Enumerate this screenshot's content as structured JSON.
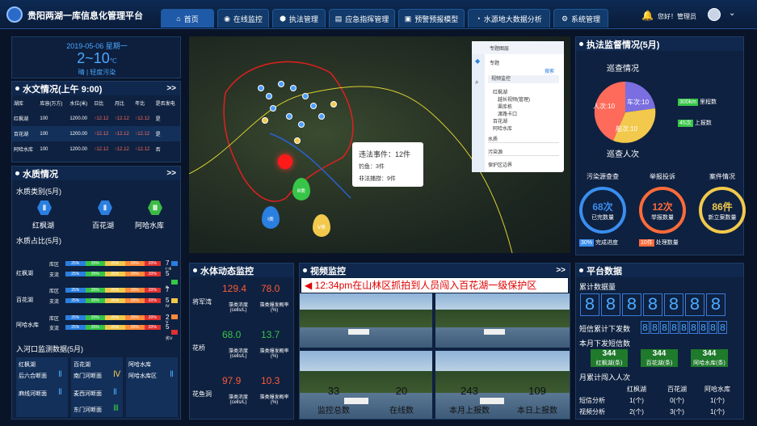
{
  "app": {
    "title": "贵阳两湖一库信息化管理平台"
  },
  "nav": [
    {
      "label": "首页",
      "icon": "⌂"
    },
    {
      "label": "在线监控",
      "icon": "◉"
    },
    {
      "label": "执法管理",
      "icon": "⬢"
    },
    {
      "label": "应急指挥管理",
      "icon": "▤"
    },
    {
      "label": "预警预报模型",
      "icon": "▣"
    },
    {
      "label": "水源地大数据分析",
      "icon": "◔"
    },
    {
      "label": "系统管理",
      "icon": "⚙"
    }
  ],
  "user": {
    "greeting": "您好！管理员"
  },
  "weather": {
    "date": "2019-05-06 星期一",
    "temp": "2~10",
    "unit": "℃",
    "desc": "晴 | 轻度污染"
  },
  "hydro": {
    "title": "水文情况(上午 9:00)",
    "more": ">>",
    "headers": [
      "湖库",
      "库容(万方)",
      "水位(米)",
      "日比",
      "月比",
      "年比",
      "是否发电"
    ],
    "rows": [
      [
        "红枫湖",
        "100",
        "1200.00",
        "↑12.12",
        "↑12.12",
        "↑12.12",
        "是"
      ],
      [
        "百花湖",
        "100",
        "1200.00",
        "↑12.12",
        "↑12.12",
        "↑12.12",
        "是"
      ],
      [
        "阿哈水库",
        "100",
        "1200.00",
        "↑12.12",
        "↑12.12",
        "↑12.12",
        "否"
      ]
    ]
  },
  "quality": {
    "title": "水质情况",
    "more": ">>",
    "category_title": "水质类别(5月)",
    "sites": [
      {
        "name": "红枫湖",
        "grade": "Ⅱ"
      },
      {
        "name": "百花湖",
        "grade": "Ⅱ"
      },
      {
        "name": "阿哈水库",
        "grade": "Ⅲ"
      }
    ],
    "share_title": "水质占比(5月)",
    "lakes": [
      "红枫湖",
      "百花湖",
      "阿哈水库"
    ],
    "sub": [
      "库区",
      "支流"
    ],
    "pct": "25%",
    "pct2": "20%",
    "counts": [
      "7",
      "5",
      "7",
      "5",
      "2",
      "5"
    ],
    "legend": [
      "Ⅰ~Ⅱ",
      "Ⅲ",
      "Ⅳ",
      "Ⅴ",
      "劣Ⅴ"
    ],
    "inflow_title": "入河口监测数据(5月)",
    "inflow_heads": [
      "红枫湖",
      "百花湖",
      "阿哈水库"
    ],
    "inflow": [
      [
        "后六合断面",
        "Ⅱ",
        "南门河断面",
        "Ⅳ",
        "阿哈水库区",
        "Ⅱ"
      ],
      [
        "麻线河断面",
        "Ⅱ",
        "麦西河断面",
        "Ⅱ",
        "",
        ""
      ],
      [
        "",
        "",
        "东门河断面",
        "Ⅲ",
        "",
        ""
      ]
    ]
  },
  "map": {
    "violation_title": "违法事件：12件",
    "fishing": "钓鱼：3件",
    "hunting": "非法捕捞：9件",
    "drops": [
      "Ⅰ类",
      "Ⅲ类",
      "Ⅴ类"
    ],
    "layers": {
      "title": "专题图层",
      "tab": "专题",
      "search": "搜索",
      "items": [
        "视频监控",
        "红枫湖",
        "越长视频(管理)",
        "渠库栋",
        "渡路卡口",
        "百花湖",
        "阿哈水库",
        "水质",
        "污染源",
        "保护区边界"
      ]
    }
  },
  "dynamic": {
    "title": "水体动态监控",
    "label1": "藻类浓度",
    "unit1": "(cells/L)",
    "label2": "藻类爆发概率",
    "unit2": "(%)",
    "rows": [
      {
        "name": "将军湾",
        "v1": "129.4",
        "v2": "78.0",
        "c": "#ff5a36"
      },
      {
        "name": "花桥",
        "v1": "68.0",
        "v2": "13.7",
        "c": "#36c548"
      },
      {
        "name": "花鱼洞",
        "v1": "97.9",
        "v2": "10.3",
        "c": "#ff5a36"
      }
    ]
  },
  "video": {
    "title": "视频监控",
    "more": ">>",
    "alert": "12:34pm在山林区抓拍到人员闯入百花湖一级保护区",
    "stats": [
      {
        "v": "33",
        "l": "监控总数"
      },
      {
        "v": "20",
        "l": "在线数"
      },
      {
        "v": "243",
        "l": "本月上报数"
      },
      {
        "v": "109",
        "l": "本日上报数"
      }
    ]
  },
  "law": {
    "title": "执法监督情况(5月)",
    "patrol": "巡查情况",
    "patrol_people": "巡查人次",
    "pie": [
      {
        "l": "车次:10",
        "c": "#7a6ee0"
      },
      {
        "l": "船次:10",
        "c": "#f2c94c"
      },
      {
        "l": "人次:10",
        "c": "#ff6b5a"
      }
    ],
    "km": "300km",
    "km_l": "里程数",
    "rep": "45次",
    "rep_l": "上报数",
    "cards": [
      {
        "t": "污染源查查",
        "v": "68次",
        "s": "已完数量",
        "c": "#3a8ef0"
      },
      {
        "t": "举报投诉",
        "v": "12次",
        "s": "举报数量",
        "c": "#ff6b3a"
      },
      {
        "t": "案件情况",
        "v": "86件",
        "s": "新立案数量",
        "c": "#f2c94c"
      }
    ],
    "progress": "30%",
    "progress_l": "完成进度",
    "handle": "10件",
    "handle_l": "处理数量"
  },
  "platform": {
    "title": "平台数据",
    "acc_title": "累计数据量",
    "digits": [
      "8",
      "8",
      "8",
      "8",
      "8",
      "8",
      "8"
    ],
    "sms_title": "短信累计下发数",
    "sms_digits": [
      "8",
      "8",
      "8",
      "8",
      "8",
      "8",
      "8",
      "8",
      "8"
    ],
    "month_sms": "本月下发短信数",
    "month": [
      {
        "v": "344",
        "l": "红枫湖(条)"
      },
      {
        "v": "344",
        "l": "百花湖(条)"
      },
      {
        "v": "344",
        "l": "阿哈水库(条)"
      }
    ],
    "intrude": "月累计闯入人次",
    "heads": [
      "红枫湖",
      "百花湖",
      "阿哈水库"
    ],
    "rows": [
      {
        "n": "短信分析",
        "v": [
          "1(个)",
          "0(个)",
          "1(个)"
        ]
      },
      {
        "n": "视频分析",
        "v": [
          "2(个)",
          "3(个)",
          "1(个)"
        ]
      }
    ]
  }
}
